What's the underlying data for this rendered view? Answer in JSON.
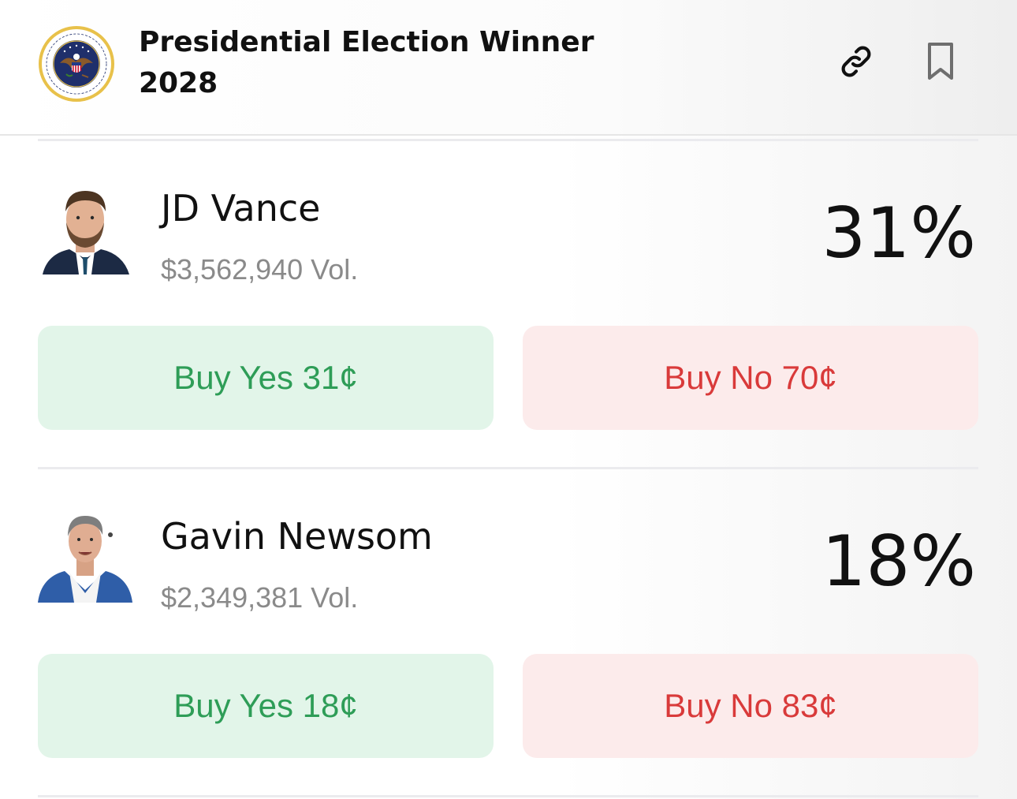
{
  "header": {
    "title_line1": "Presidential Election Winner",
    "title_line2": "2028",
    "seal_text": "SEAL OF THE PRESIDENT OF THE UNITED STATES",
    "icons": [
      "seal-icon",
      "link-icon",
      "bookmark-icon"
    ]
  },
  "candidates": [
    {
      "name": "JD Vance",
      "volume": "$3,562,940 Vol.",
      "chance": "31%",
      "buy_yes": "Buy Yes 31¢",
      "buy_no": "Buy No 70¢"
    },
    {
      "name": "Gavin Newsom",
      "volume": "$2,349,381 Vol.",
      "chance": "18%",
      "buy_yes": "Buy Yes 18¢",
      "buy_no": "Buy No 83¢"
    }
  ],
  "colors": {
    "yes_bg": "#e2f5e9",
    "yes_text": "#2e9d57",
    "no_bg": "#fcebeb",
    "no_text": "#d93a3a",
    "volume_text": "#8a8a8a"
  }
}
